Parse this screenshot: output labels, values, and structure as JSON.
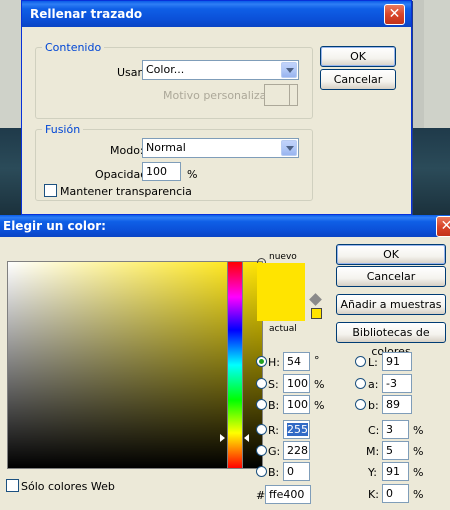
{
  "fill_path": {
    "title": "Rellenar trazado",
    "contents_legend": "Contenido",
    "use_label": "Usar:",
    "use_value": "Color...",
    "pattern_label": "Motivo personalizado:",
    "blending_legend": "Fusión",
    "mode_label": "Modo:",
    "mode_value": "Normal",
    "opacity_label": "Opacidad:",
    "opacity_value": "100",
    "opacity_unit": "%",
    "preserve_label": "Mantener transparencia",
    "ok_label": "OK",
    "cancel_label": "Cancelar",
    "close_glyph": "✕"
  },
  "color_picker": {
    "title": "Elegir un color:",
    "new_label": "nuevo",
    "current_label": "actual",
    "ok_label": "OK",
    "cancel_label": "Cancelar",
    "add_swatches_label": "Añadir a muestras",
    "libraries_label": "Bibliotecas de colores",
    "web_only_label": "Sólo colores Web",
    "close_glyph": "✕",
    "color": "#ffe400",
    "hsb": {
      "h_label": "H:",
      "h_value": "54",
      "h_unit": "°",
      "s_label": "S:",
      "s_value": "100",
      "s_unit": "%",
      "b_label": "B:",
      "b_value": "100",
      "b_unit": "%"
    },
    "rgb": {
      "r_label": "R:",
      "r_value": "255",
      "g_label": "G:",
      "g_value": "228",
      "b_label": "B:",
      "b_value": "0"
    },
    "lab": {
      "l_label": "L:",
      "l_value": "91",
      "a_label": "a:",
      "a_value": "-3",
      "b_label": "b:",
      "b_value": "89"
    },
    "cmyk": {
      "c_label": "C:",
      "c_value": "3",
      "m_label": "M:",
      "m_value": "5",
      "y_label": "Y:",
      "y_value": "91",
      "k_label": "K:",
      "k_value": "0",
      "unit": "%"
    },
    "hex_label": "#",
    "hex_value": "ffe400"
  }
}
